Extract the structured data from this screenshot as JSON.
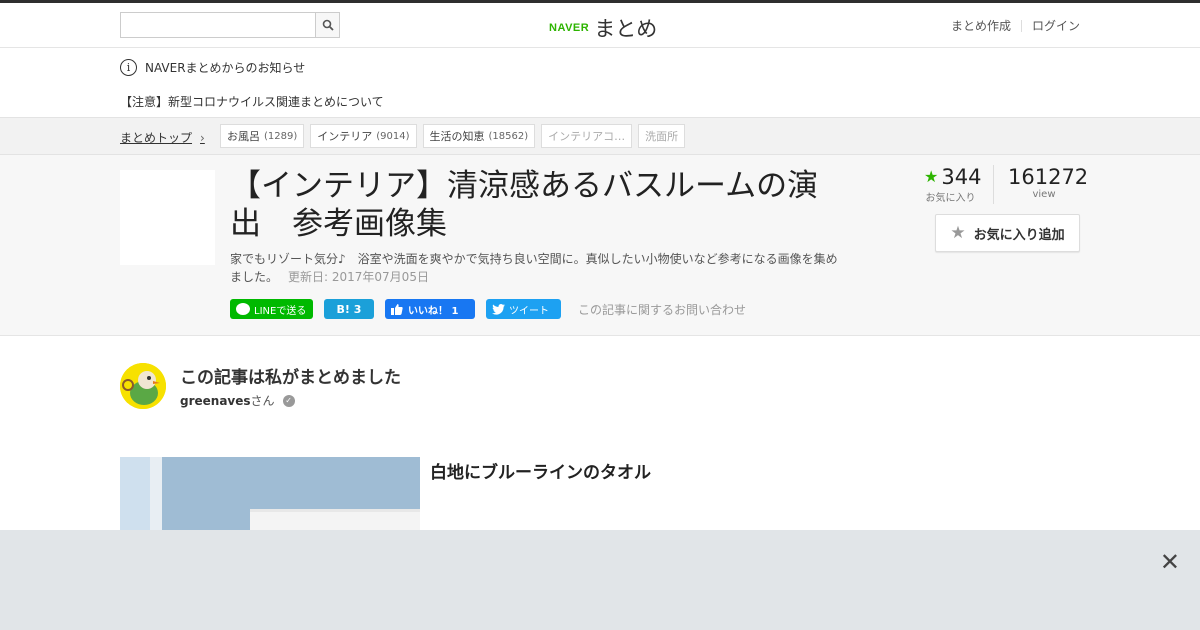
{
  "header": {
    "search_placeholder": "",
    "logo_naver": "NAVER",
    "logo_matome": "まとめ",
    "nav_create": "まとめ作成",
    "nav_login": "ログイン"
  },
  "notice": {
    "info_glyph": "i",
    "title": "NAVERまとめからのお知らせ",
    "message": "【注意】新型コロナウイルス関連まとめについて"
  },
  "breadcrumb": {
    "top_label": "まとめトップ",
    "chevron": "›",
    "tags": [
      {
        "label": "お風呂",
        "count": "(1289)"
      },
      {
        "label": "インテリア",
        "count": "(9014)"
      },
      {
        "label": "生活の知恵",
        "count": "(18562)"
      },
      {
        "label": "インテリアコ…",
        "count": ""
      },
      {
        "label": "洗面所",
        "count": ""
      }
    ]
  },
  "article": {
    "title": "【インテリア】清涼感あるバスルームの演出　参考画像集",
    "description": "家でもリゾート気分♪　浴室や洗面を爽やかで気持ち良い空間に。真似したい小物使いなど参考になる画像を集めました。",
    "updated": "更新日: 2017年07月05日",
    "fav_count": "344",
    "fav_label": "お気に入り",
    "view_count": "161272",
    "view_label": "view",
    "fav_button": "お気に入り追加",
    "contact": "この記事に関するお問い合わせ"
  },
  "shares": {
    "line": "LINEで送る",
    "hatena": "B! 3",
    "facebook": "いいね！ 1",
    "twitter": "ツイート"
  },
  "author": {
    "heading": "この記事は私がまとめました",
    "name": "greenaves",
    "suffix": "さん"
  },
  "item": {
    "title": "白地にブルーラインのタオル"
  },
  "ad": {
    "close_glyph": "✕"
  },
  "colors": {
    "accent_green": "#2db400",
    "line_green": "#00b900",
    "hatena_blue": "#1ba0d9",
    "facebook_blue": "#1877f2",
    "twitter_blue": "#1da1f2"
  }
}
